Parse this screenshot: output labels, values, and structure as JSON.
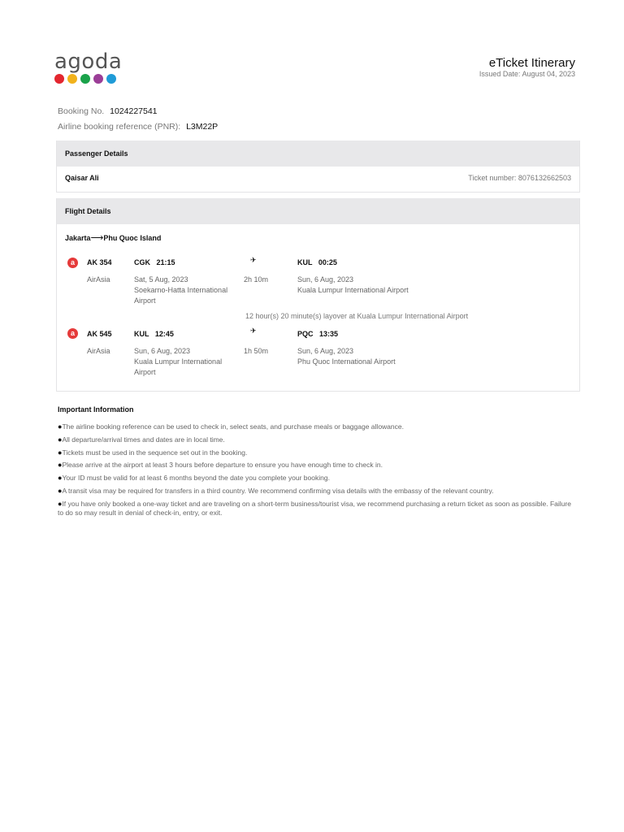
{
  "brand": {
    "name": "agoda",
    "dot_colors": [
      "#e3262f",
      "#f1b21c",
      "#1aa24a",
      "#9b3e97",
      "#1f9bd7"
    ]
  },
  "header": {
    "title": "eTicket Itinerary",
    "issued": "Issued Date: August 04, 2023"
  },
  "booking": {
    "number_label": "Booking No.",
    "number": "1024227541",
    "pnr_label": "Airline booking reference (PNR):",
    "pnr": "L3M22P"
  },
  "passenger": {
    "heading": "Passenger Details",
    "name": "Qaisar Ali",
    "ticket": "Ticket number: 8076132662503"
  },
  "flight": {
    "heading": "Flight Details",
    "route_from": "Jakarta",
    "route_arrow": "⟶",
    "route_to": "Phu Quoc Island",
    "legs": [
      {
        "flight_no": "AK 354",
        "airline": "AirAsia",
        "dep_code_time": "CGK   21:15",
        "dep_date": "Sat, 5 Aug, 2023",
        "dep_airport": "Soekarno-Hatta International Airport",
        "duration": "2h 10m",
        "arr_code_time": "KUL   00:25",
        "arr_date": "Sun, 6 Aug, 2023",
        "arr_airport": "Kuala Lumpur International Airport"
      },
      {
        "flight_no": "AK 545",
        "airline": "AirAsia",
        "dep_code_time": "KUL   12:45",
        "dep_date": "Sun, 6 Aug, 2023",
        "dep_airport": "Kuala Lumpur International Airport",
        "duration": "1h 50m",
        "arr_code_time": "PQC   13:35",
        "arr_date": "Sun, 6 Aug, 2023",
        "arr_airport": "Phu Quoc International Airport"
      }
    ],
    "layover": "12 hour(s) 20 minute(s) layover at Kuala Lumpur International Airport"
  },
  "info": {
    "title": "Important Information",
    "items": [
      "The airline booking reference can be used to check in, select seats, and purchase meals or baggage allowance.",
      "All departure/arrival times and dates are in local time.",
      "Tickets must be used in the sequence set out in the booking.",
      "Please arrive at the airport at least 3 hours before departure to ensure you have enough time to check in.",
      "Your ID must be valid for at least 6 months beyond the date you complete your booking.",
      "A transit visa may be required for transfers in a third country. We recommend confirming visa details with the embassy of the relevant country.",
      "If you have only booked a one-way ticket and are traveling on a short-term business/tourist visa, we recommend purchasing a return ticket as soon as possible. Failure to do so may result in denial of check-in, entry, or exit."
    ]
  }
}
